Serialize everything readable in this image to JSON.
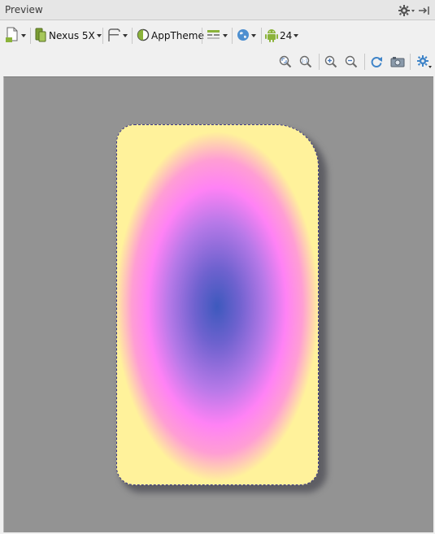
{
  "panel": {
    "title": "Preview"
  },
  "toolbar": {
    "device_label": "Nexus 5X",
    "theme_label": "AppTheme",
    "api_label": "24"
  },
  "colors": {
    "canvas": "#939393",
    "gradient_center": "#3d59bd",
    "gradient_mid": "#ff82f5",
    "gradient_edge": "#fff29b",
    "outline": "#3e3b85"
  },
  "icons": [
    "gear-icon",
    "hide-panel-icon",
    "render-file-icon",
    "device-icon",
    "orientation-icon",
    "theme-icon",
    "activity-icon",
    "locale-icon",
    "android-icon",
    "zoom-to-fit-icon",
    "zoom-actual-icon",
    "zoom-in-icon",
    "zoom-out-icon",
    "refresh-icon",
    "screenshot-icon",
    "settings-icon"
  ]
}
